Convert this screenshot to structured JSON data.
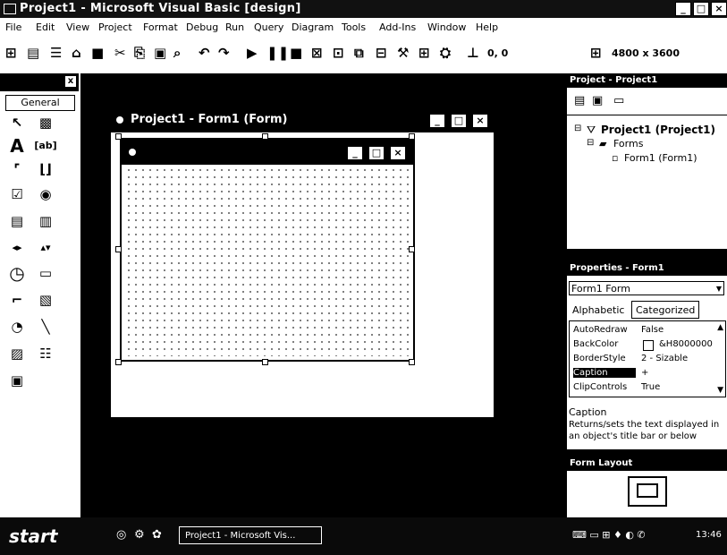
{
  "window": {
    "title": "Project1 - Microsoft Visual Basic [design]"
  },
  "menu": [
    "File",
    "Edit",
    "View",
    "Project",
    "Format",
    "Debug",
    "Run",
    "Query",
    "Diagram",
    "Tools",
    "Add-Ins",
    "Window",
    "Help"
  ],
  "toolbar": {
    "position": "0, 0",
    "size": "4800 x 3600"
  },
  "toolbox": {
    "tab": "General"
  },
  "designer": {
    "title": "Project1 - Form1 (Form)"
  },
  "project_explorer": {
    "title": "Project - Project1",
    "project": "Project1 (Project1)",
    "folder": "Forms",
    "form": "Form1 (Form1)"
  },
  "properties": {
    "title": "Properties - Form1",
    "object": "Form1  Form",
    "tabs": [
      "Alphabetic",
      "Categorized"
    ],
    "rows": [
      {
        "name": "AutoRedraw",
        "value": "False"
      },
      {
        "name": "BackColor",
        "value": "&H8000000"
      },
      {
        "name": "BorderStyle",
        "value": "2 - Sizable"
      },
      {
        "name": "Caption",
        "value": "+"
      },
      {
        "name": "ClipControls",
        "value": "True"
      }
    ],
    "desc_title": "Caption",
    "desc_text": "Returns/sets the text displayed in an object's title bar or below"
  },
  "form_layout": {
    "title": "Form Layout"
  },
  "taskbar": {
    "start": "start",
    "task": "Project1 - Microsoft Vis...",
    "clock": "13:46"
  }
}
